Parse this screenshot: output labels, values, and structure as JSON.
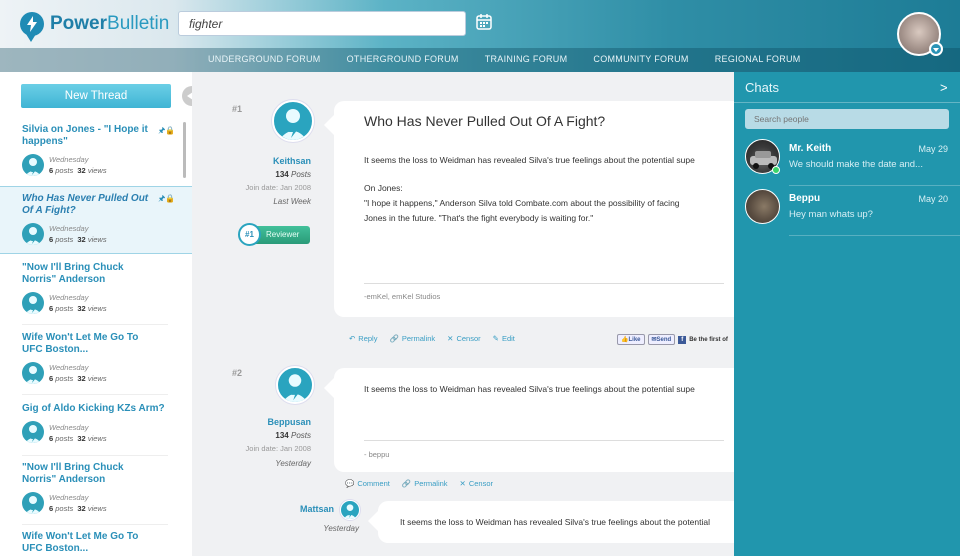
{
  "header": {
    "logo_bold": "Power",
    "logo_light": "Bulletin",
    "search_value": "fighter",
    "nav": [
      "UNDERGROUND FORUM",
      "OTHERGROUND FORUM",
      "TRAINING FORUM",
      "COMMUNITY FORUM",
      "REGIONAL FORUM"
    ]
  },
  "sidebar": {
    "new_thread": "New Thread",
    "threads": [
      {
        "title": "Silvia on Jones - \"I Hope it happens\"",
        "day": "Wednesday",
        "posts": "6",
        "posts_label": "posts",
        "views": "32",
        "views_label": "views"
      },
      {
        "title": "Who Has Never Pulled Out Of A Fight?",
        "day": "Wednesday",
        "posts": "6",
        "posts_label": "posts",
        "views": "32",
        "views_label": "views"
      },
      {
        "title": "\"Now I'll Bring Chuck Norris\" Anderson",
        "day": "Wednesday",
        "posts": "6",
        "posts_label": "posts",
        "views": "32",
        "views_label": "views"
      },
      {
        "title": "Wife Won't Let Me Go To UFC Boston...",
        "day": "Wednesday",
        "posts": "6",
        "posts_label": "posts",
        "views": "32",
        "views_label": "views"
      },
      {
        "title": "Gig of Aldo Kicking KZs Arm?",
        "day": "Wednesday",
        "posts": "6",
        "posts_label": "posts",
        "views": "32",
        "views_label": "views"
      },
      {
        "title": "\"Now I'll Bring Chuck Norris\" Anderson",
        "day": "Wednesday",
        "posts": "6",
        "posts_label": "posts",
        "views": "32",
        "views_label": "views"
      },
      {
        "title": "Wife Won't Let Me Go To UFC Boston...",
        "day": "",
        "posts": "",
        "posts_label": "",
        "views": "",
        "views_label": ""
      }
    ]
  },
  "posts": [
    {
      "num": "#1",
      "user": "Keithsan",
      "posts": "134",
      "posts_label": "Posts",
      "join": "Join date: Jan 2008",
      "when": "Last Week",
      "badge_num": "#1",
      "badge_label": "Reviewer",
      "title": "Who Has Never Pulled Out Of A Fight?",
      "body1": "It seems the loss to Weidman has revealed Silva's true feelings about the potential supe",
      "body2": "On Jones:",
      "body3": "\"I hope it happens,\" Anderson Silva told Combate.com about the possibility of facing",
      "body4": "Jones in the future. \"That's the fight everybody is waiting for.\"",
      "sig": "-emKel, emKel Studios",
      "actions": [
        "Reply",
        "Permalink",
        "Censor",
        "Edit"
      ],
      "fb_like": "Like",
      "fb_send": "Send",
      "fb_text": "Be the first of"
    },
    {
      "num": "#2",
      "user": "Beppusan",
      "posts": "134",
      "posts_label": "Posts",
      "join": "Join date: Jan 2008",
      "when": "Yesterday",
      "body1": "It seems the loss to Weidman has revealed Silva's true feelings about the potential supe",
      "sig": "- beppu",
      "actions": [
        "Comment",
        "Permalink",
        "Censor"
      ]
    },
    {
      "user": "Mattsan",
      "when": "Yesterday",
      "body1": "It seems the loss to Weidman has revealed Silva's true feelings about the potential"
    }
  ],
  "chats": {
    "title": "Chats",
    "close": ">",
    "search_placeholder": "Search people",
    "items": [
      {
        "name": "Mr. Keith",
        "date": "May 29",
        "msg": "We should make the date and..."
      },
      {
        "name": "Beppu",
        "date": "May 20",
        "msg": "Hey man whats up?"
      }
    ]
  },
  "colors": {
    "accent": "#2a8fb8",
    "chat_bg": "#2196ad",
    "reviewer": "#2a9a78"
  }
}
